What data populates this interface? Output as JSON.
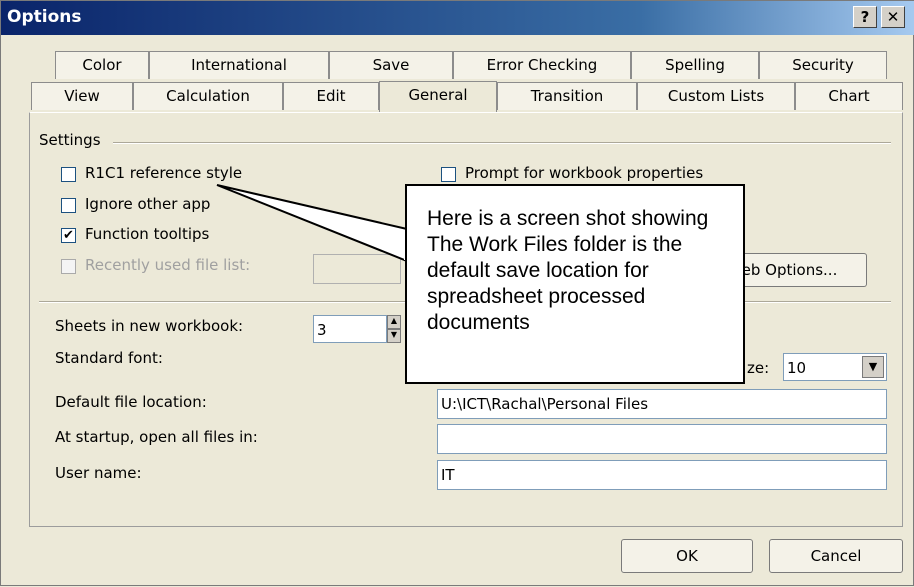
{
  "window": {
    "title": "Options",
    "help_label": "?",
    "close_label": "✕"
  },
  "tabs_row1": [
    "Color",
    "International",
    "Save",
    "Error Checking",
    "Spelling",
    "Security"
  ],
  "tabs_row2": [
    "View",
    "Calculation",
    "Edit",
    "General",
    "Transition",
    "Custom Lists",
    "Chart"
  ],
  "active_tab": "General",
  "settings": {
    "group_label": "Settings",
    "r1c1": {
      "label": "R1C1 reference style",
      "checked": false
    },
    "ignore_other": {
      "label": "Ignore other applications",
      "label_visible": "Ignore other app",
      "checked": false
    },
    "function_tooltips": {
      "label": "Function tooltips",
      "checked": true
    },
    "recent_files": {
      "label": "Recently used file list:",
      "checked": false,
      "disabled": true
    },
    "prompt_props": {
      "label": "Prompt for workbook properties",
      "checked": false
    },
    "web_options_label": "eb Options..."
  },
  "sheets": {
    "label": "Sheets in new workbook:",
    "value": "3"
  },
  "standard_font": {
    "label": "Standard font:",
    "size_label": "ze:",
    "size_value": "10"
  },
  "default_location": {
    "label": "Default file location:",
    "value": "U:\\ICT\\Rachal\\Personal Files"
  },
  "startup_folder": {
    "label": "At startup, open all files in:",
    "value": ""
  },
  "user_name": {
    "label": "User name:",
    "value": "IT"
  },
  "buttons": {
    "ok": "OK",
    "cancel": "Cancel"
  },
  "callout": {
    "text": "Here is a screen shot showing The Work Files folder is the default save location for spreadsheet processed documents"
  }
}
